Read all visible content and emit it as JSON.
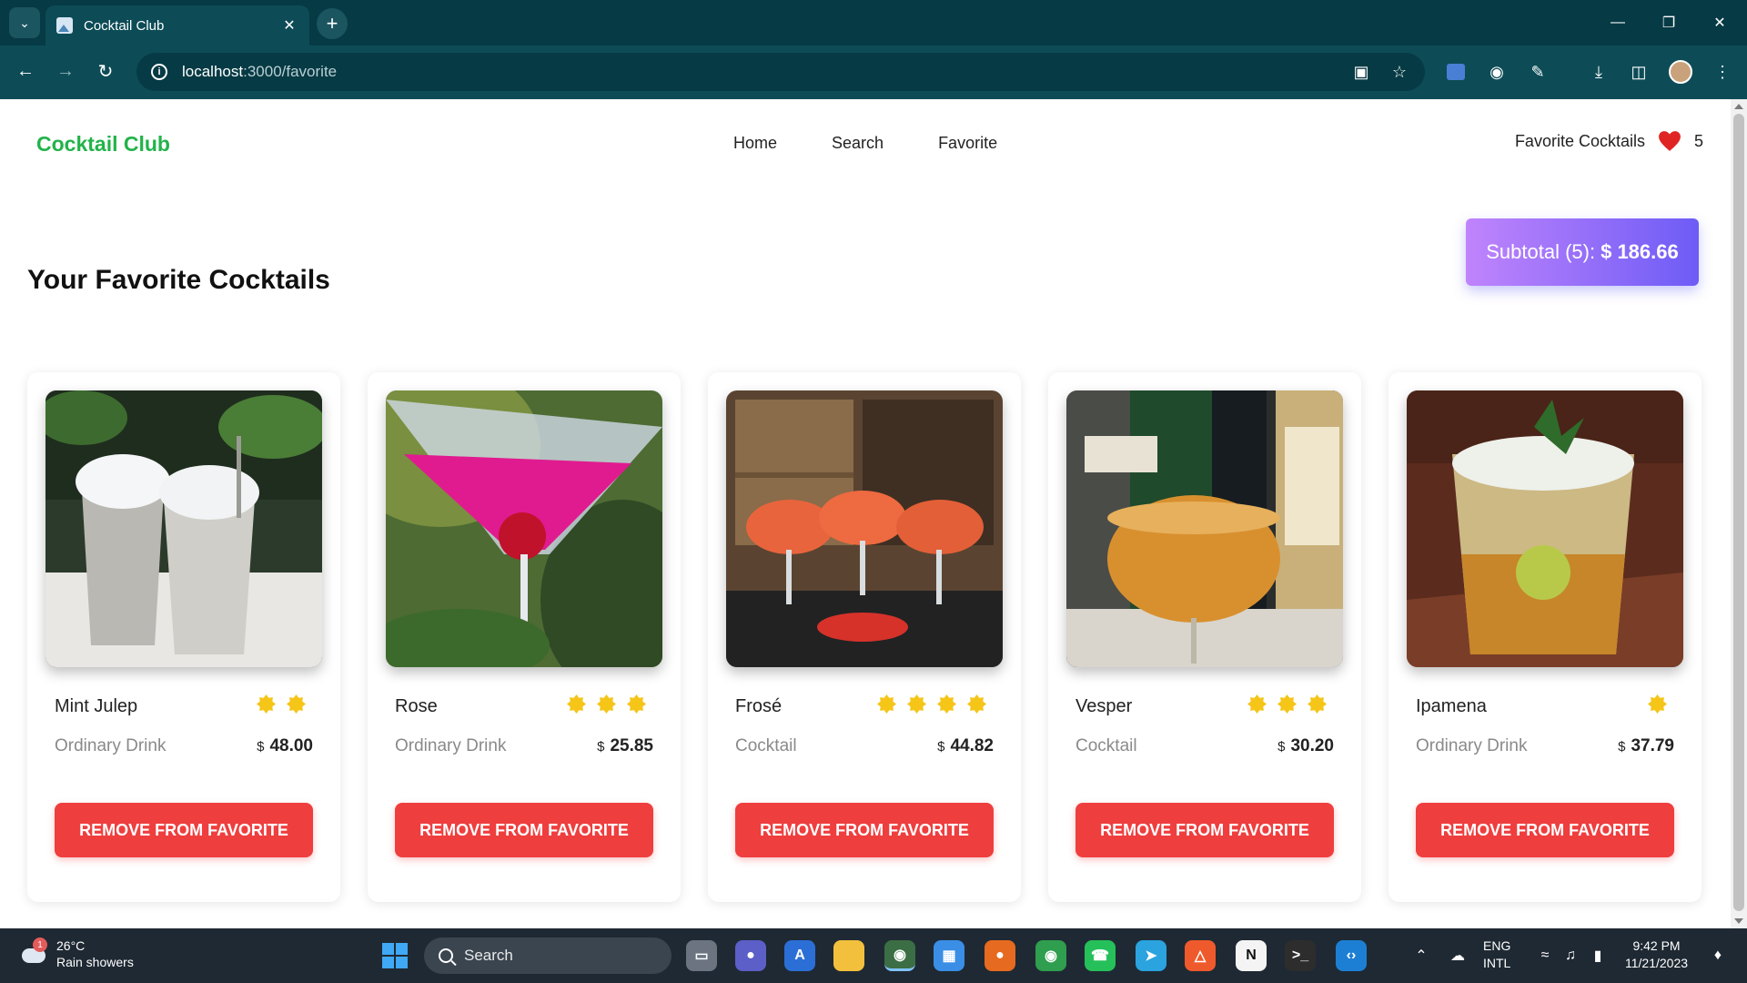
{
  "browser": {
    "tab_title": "Cocktail Club",
    "url_host": "localhost",
    "url_path": ":3000/favorite"
  },
  "header": {
    "brand": "Cocktail Club",
    "nav": [
      "Home",
      "Search",
      "Favorite"
    ],
    "favorites_label": "Favorite Cocktails",
    "favorites_count": "5"
  },
  "main": {
    "title": "Your Favorite Cocktails",
    "subtotal_label": "Subtotal (5):",
    "subtotal_value": "$ 186.66",
    "remove_label": "REMOVE FROM FAVORITE",
    "currency": "$",
    "cards": [
      {
        "name": "Mint Julep",
        "rating": 2,
        "category": "Ordinary Drink",
        "price": "48.00"
      },
      {
        "name": "Rose",
        "rating": 3,
        "category": "Ordinary Drink",
        "price": "25.85"
      },
      {
        "name": "Frosé",
        "rating": 4,
        "category": "Cocktail",
        "price": "44.82"
      },
      {
        "name": "Vesper",
        "rating": 3,
        "category": "Cocktail",
        "price": "30.20"
      },
      {
        "name": "Ipamena",
        "rating": 1,
        "category": "Ordinary Drink",
        "price": "37.79"
      }
    ]
  },
  "colors": {
    "brand": "#22b34a",
    "remove_button": "#ef3e3e",
    "star": "#f5c518",
    "heart": "#e02424"
  },
  "taskbar": {
    "weather_temp": "26°C",
    "weather_desc": "Rain showers",
    "weather_badge": "1",
    "search_label": "Search",
    "lang_top": "ENG",
    "lang_bottom": "INTL",
    "time": "9:42 PM",
    "date": "11/21/2023"
  }
}
